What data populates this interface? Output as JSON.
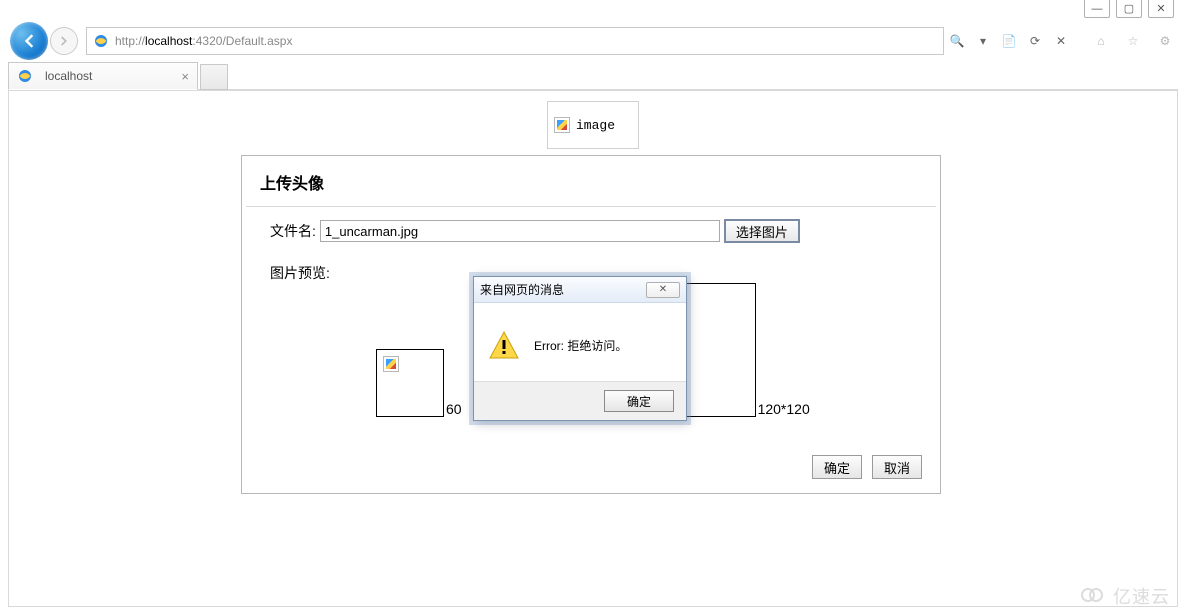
{
  "window": {
    "minimize": "—",
    "maximize": "▢",
    "close": "✕"
  },
  "browser": {
    "url_prefix": "http://",
    "url_host": "localhost",
    "url_port": ":4320",
    "url_path": "/Default.aspx",
    "tab_title": "localhost",
    "search_glyph": "🔍",
    "dropdown_glyph": "▾",
    "compat_glyph": "📄",
    "refresh_glyph": "⟳",
    "stop_glyph": "✕",
    "home_glyph": "⌂",
    "fav_glyph": "☆",
    "gear_glyph": "⚙"
  },
  "page": {
    "image_placeholder_label": "image",
    "card_title": "上传头像",
    "filename_label": "文件名:",
    "filename_value": "1_uncarman.jpg",
    "choose_button": "选择图片",
    "preview_label": "图片预览:",
    "dim60": "60",
    "dim120": "120*120",
    "ok_button": "确定",
    "cancel_button": "取消"
  },
  "dialog": {
    "title": "来自网页的消息",
    "message": "Error: 拒绝访问。",
    "ok_button": "确定",
    "close_glyph": "✕"
  },
  "watermark": {
    "text": "亿速云"
  }
}
